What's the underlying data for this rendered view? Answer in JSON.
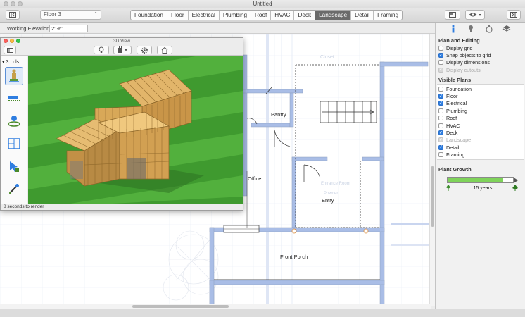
{
  "window": {
    "title": "Untitled"
  },
  "toolbar": {
    "floor_select": "Floor 3",
    "tabs": [
      {
        "label": "Foundation",
        "active": false
      },
      {
        "label": "Floor",
        "active": false
      },
      {
        "label": "Electrical",
        "active": false
      },
      {
        "label": "Plumbing",
        "active": false
      },
      {
        "label": "Roof",
        "active": false
      },
      {
        "label": "HVAC",
        "active": false
      },
      {
        "label": "Deck",
        "active": false
      },
      {
        "label": "Landscape",
        "active": true
      },
      {
        "label": "Detail",
        "active": false
      },
      {
        "label": "Framing",
        "active": false
      }
    ]
  },
  "elevation": {
    "label": "Working Elevation:",
    "value": "2' -6\""
  },
  "view3d": {
    "title": "3D View",
    "tool_label": "3...ols",
    "status": "8 seconds to render"
  },
  "plan": {
    "rooms": [
      {
        "name": "Pantry"
      },
      {
        "name": "Office"
      },
      {
        "name": "Entry"
      },
      {
        "name": "Front Porch"
      }
    ],
    "faded_labels": [
      "Closet",
      "Entrance Room",
      "Powder"
    ]
  },
  "sidebar": {
    "plan_editing": {
      "title": "Plan and Editing",
      "items": [
        {
          "label": "Display grid",
          "checked": false,
          "disabled": false
        },
        {
          "label": "Snap objects to grid",
          "checked": true,
          "disabled": false
        },
        {
          "label": "Display dimensions",
          "checked": false,
          "disabled": false
        },
        {
          "label": "Display cutouts",
          "checked": true,
          "disabled": true
        }
      ]
    },
    "visible_plans": {
      "title": "Visible Plans",
      "items": [
        {
          "label": "Foundation",
          "checked": false,
          "disabled": false
        },
        {
          "label": "Floor",
          "checked": true,
          "disabled": false
        },
        {
          "label": "Electrical",
          "checked": true,
          "disabled": false
        },
        {
          "label": "Plumbing",
          "checked": false,
          "disabled": false
        },
        {
          "label": "Roof",
          "checked": false,
          "disabled": false
        },
        {
          "label": "HVAC",
          "checked": false,
          "disabled": false
        },
        {
          "label": "Deck",
          "checked": true,
          "disabled": false
        },
        {
          "label": "Landscape",
          "checked": true,
          "disabled": true
        },
        {
          "label": "Detail",
          "checked": true,
          "disabled": false
        },
        {
          "label": "Framing",
          "checked": false,
          "disabled": false
        }
      ]
    },
    "plant_growth": {
      "title": "Plant Growth",
      "value_label": "15 years",
      "fraction": 0.85
    }
  },
  "colors": {
    "accent": "#2e7de0",
    "wall": "#a9bde6",
    "grass": "#3f9a2f",
    "framing": "#d8a858",
    "growth": "#7fd35a"
  },
  "icons": [
    "sidebar-toggle-icon",
    "eye-icon",
    "info-icon",
    "plant-icon",
    "tree-icon",
    "bulb-icon",
    "camera-icon",
    "gear-icon",
    "home-icon"
  ]
}
